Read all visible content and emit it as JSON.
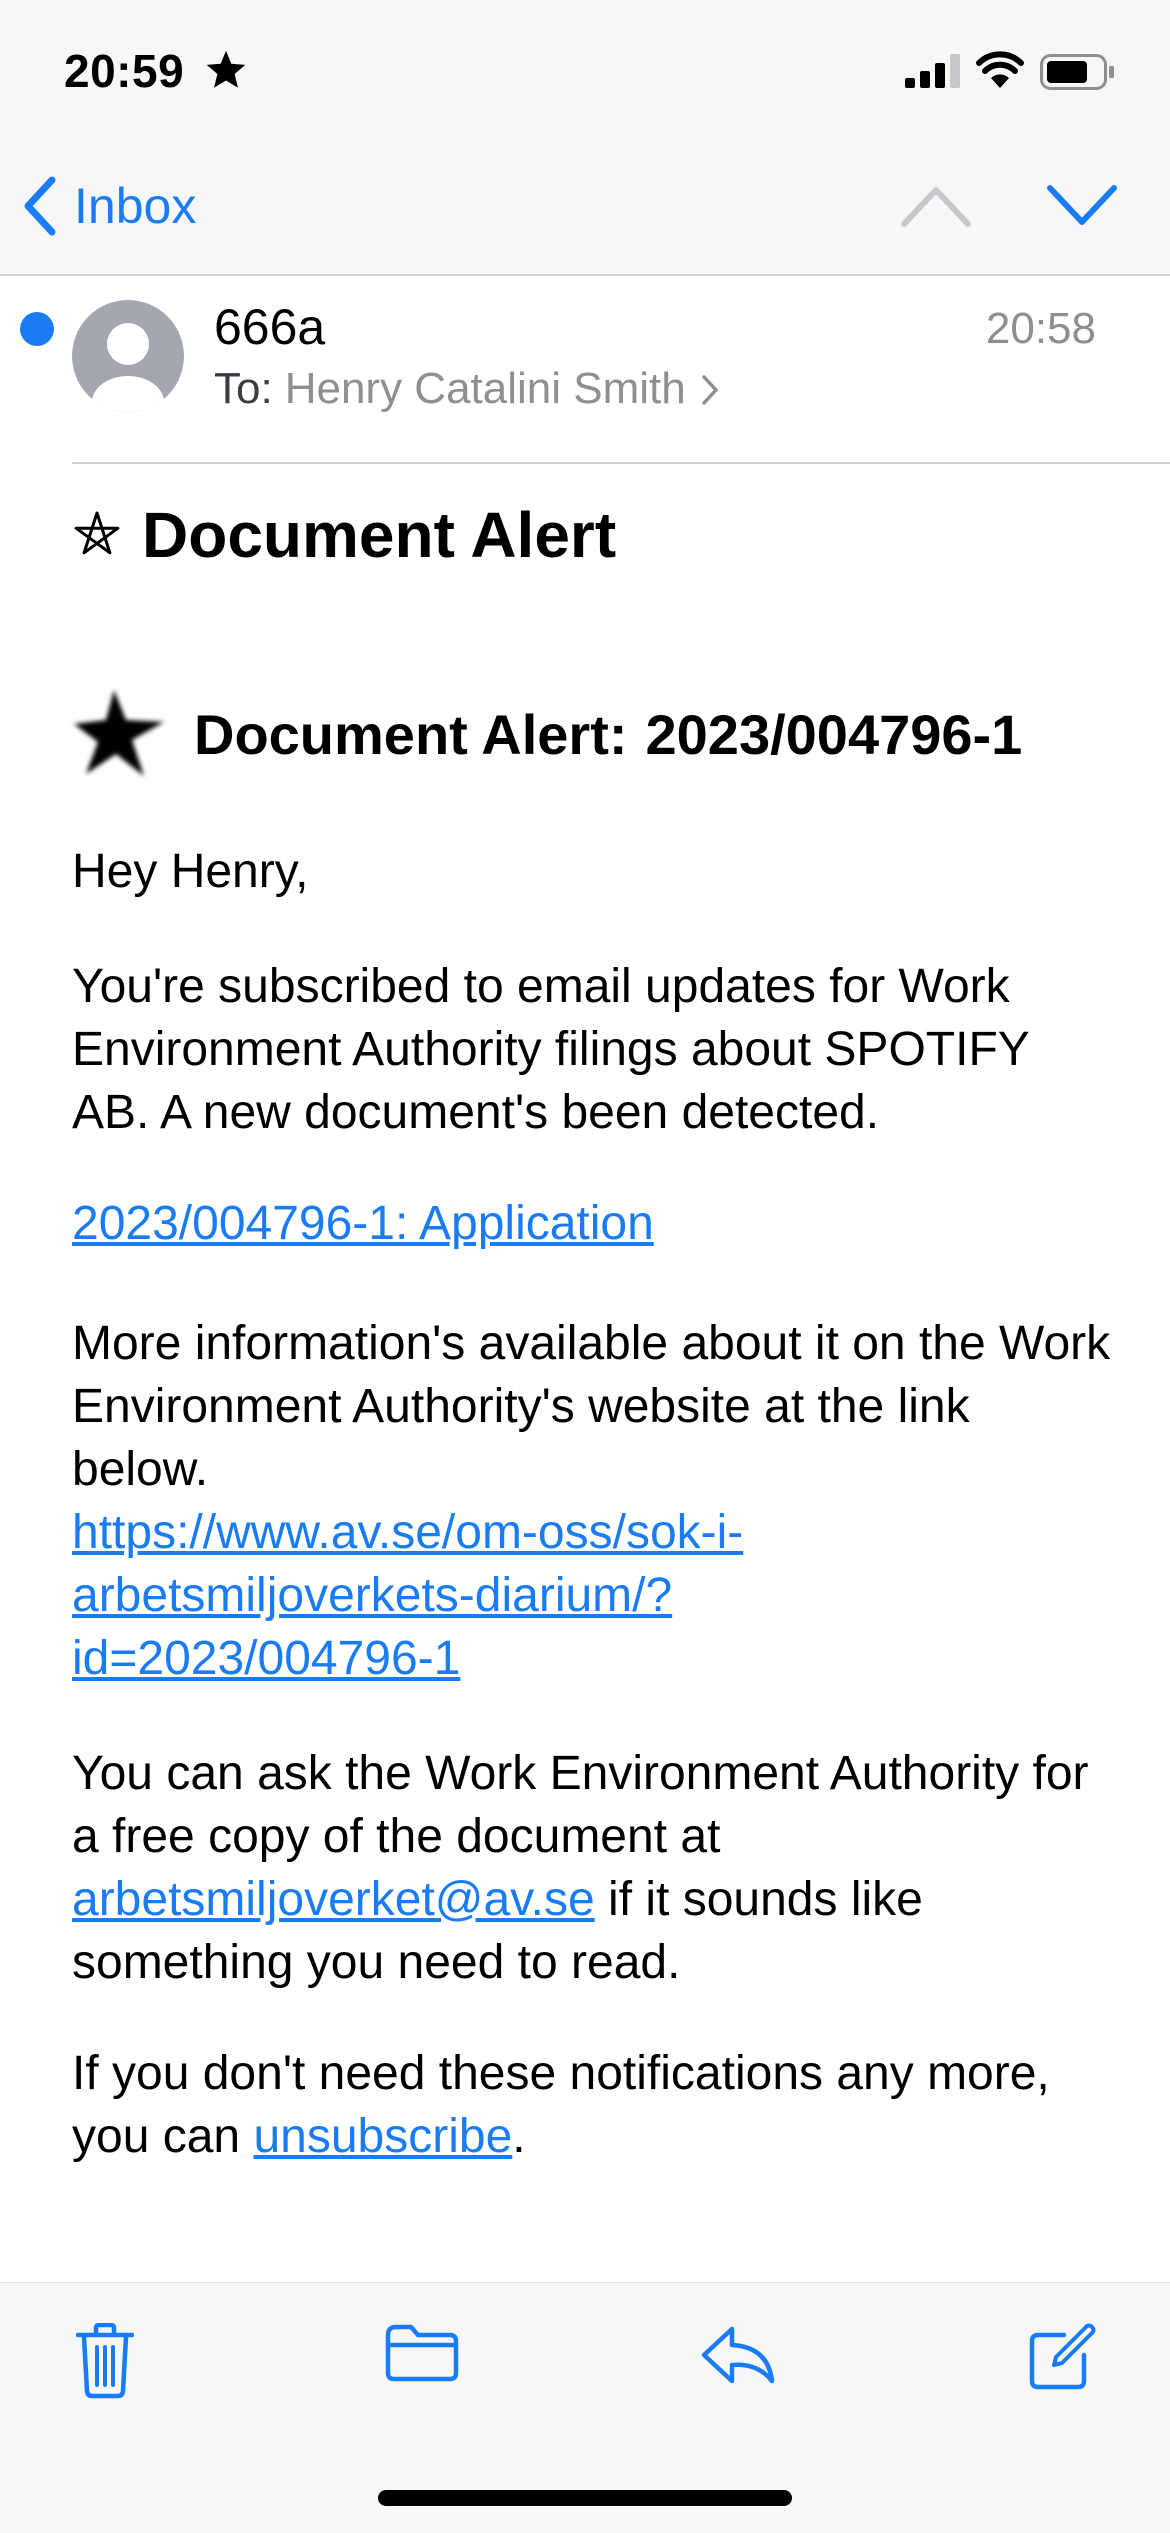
{
  "status_bar": {
    "time": "20:59"
  },
  "nav": {
    "back_label": "Inbox"
  },
  "header": {
    "sender": "666a",
    "received_time": "20:58",
    "to_label": "To:",
    "to_name": "Henry Catalini Smith"
  },
  "subject": "Document Alert",
  "body": {
    "alert_heading_prefix": "Document Alert:",
    "alert_heading_number": "2023/004796-1",
    "greeting": "Hey Henry,",
    "subscribed_text": "You're subscribed to email updates for Work Environment Authority filings about SPOTIFY AB. A new document's been detected.",
    "document_link": "2023/004796-1: Application",
    "more_info_text": "More information's available about it on the Work Environment Authority's website at the link below.",
    "more_info_link_line1": "https://www.av.se/om-oss/sok-i-",
    "more_info_link_line2": "arbetsmiljoverkets-diarium/?",
    "more_info_link_line3": "id=2023/004796-1",
    "ask_copy_text": "You can ask the Work Environment Authority for a free copy of the document at",
    "email_link": "arbetsmiljoverket@av.se",
    "ask_copy_suffix": "if it sounds like something you need to read.",
    "unsub_prefix": "If you don't need these notifications any more, you can",
    "unsub_link": "unsubscribe",
    "unsub_suffix": "."
  },
  "toolbar": {
    "icons": [
      "trash-icon",
      "folder-icon",
      "reply-icon",
      "compose-icon"
    ]
  },
  "colors": {
    "accent": "#1a7cf5",
    "secondary_text": "#8e8e93",
    "bar_background": "#f7f7f7"
  }
}
